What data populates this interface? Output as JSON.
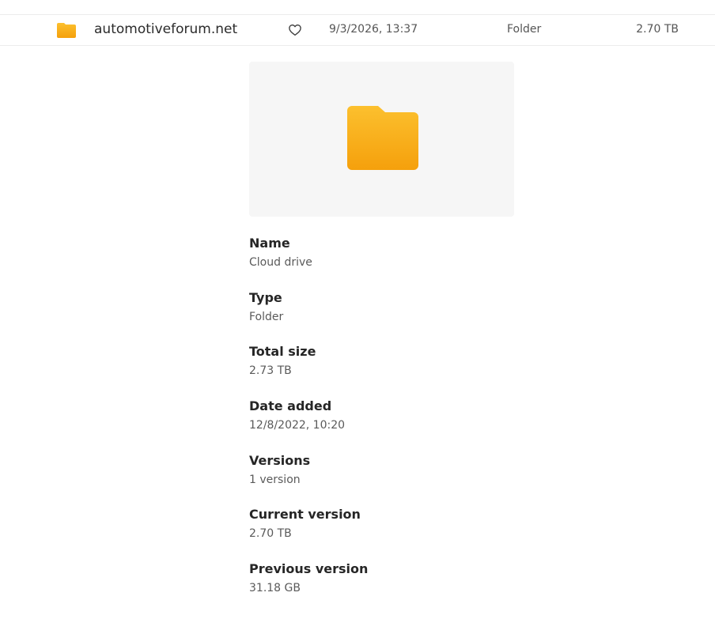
{
  "file_row": {
    "name": "automotiveforum.net",
    "date": "9/3/2026, 13:37",
    "type": "Folder",
    "size": "2.70 TB"
  },
  "details": {
    "name_label": "Name",
    "name_value": "Cloud drive",
    "type_label": "Type",
    "type_value": "Folder",
    "total_size_label": "Total size",
    "total_size_value": "2.73 TB",
    "date_added_label": "Date added",
    "date_added_value": "12/8/2022, 10:20",
    "versions_label": "Versions",
    "versions_value": "1 version",
    "current_version_label": "Current version",
    "current_version_value": "2.70 TB",
    "previous_version_label": "Previous version",
    "previous_version_value": "31.18 GB"
  },
  "colors": {
    "folder_top": "#FCC02E",
    "folder_bottom": "#F5A00C",
    "preview_bg": "#F6F6F6"
  },
  "icons": {
    "row_icon": "folder-icon",
    "favorite_icon": "heart-icon",
    "preview_icon": "folder-icon"
  }
}
